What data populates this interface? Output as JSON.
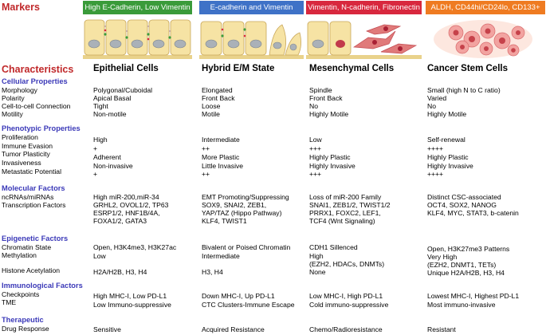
{
  "markers": {
    "title": "Markers",
    "boxes": [
      {
        "label": "High E-Cadherin, Low Vimentin",
        "color": "#3a9b3a"
      },
      {
        "label": "E-cadherin and Vimentin",
        "color": "#3f72c7"
      },
      {
        "label": "Vimentin, N-cadherin, Fibronectin",
        "color": "#d8283e"
      },
      {
        "label": "ALDH, CD44hi/CD24lo, CD133+",
        "color": "#ef7b21"
      }
    ]
  },
  "characteristics": {
    "title": "Characteristics",
    "columns": [
      "Epithelial Cells",
      "Hybrid E/M State",
      "Mesenchymal Cells",
      "Cancer Stem Cells"
    ]
  },
  "sections": [
    {
      "title": "Cellular Properties",
      "rows": [
        {
          "label": "Morphology",
          "values": [
            "Polygonal/Cuboidal",
            "Elongated",
            "Spindle",
            "Small (high N to C ratio)"
          ]
        },
        {
          "label": "Polarity",
          "values": [
            "Apical Basal",
            "Front Back",
            "Front Back",
            "Varied"
          ]
        },
        {
          "label": "Cell-to-cell Connection",
          "values": [
            "Tight",
            "Loose",
            "No",
            "No"
          ]
        },
        {
          "label": "Motility",
          "values": [
            "Non-motile",
            "Motile",
            "Highly Motile",
            "Highly Motile"
          ]
        }
      ]
    },
    {
      "title": "Phenotypic Properties",
      "rows": [
        {
          "label": "Proliferation",
          "values": [
            "High",
            "Intermediate",
            "Low",
            "Self-renewal"
          ]
        },
        {
          "label": "Immune Evasion",
          "values": [
            "+",
            "++",
            "+++",
            "++++"
          ]
        },
        {
          "label": "Tumor Plasticity",
          "values": [
            "Adherent",
            "More Plastic",
            "Highly Plastic",
            "Highly Plastic"
          ]
        },
        {
          "label": "Invasiveness",
          "values": [
            "Non-invasive",
            "Little Invasive",
            "Highly Invasive",
            "Highly Invasive"
          ]
        },
        {
          "label": "Metastatic Potential",
          "values": [
            "+",
            "++",
            "+++",
            "++++"
          ]
        }
      ]
    },
    {
      "title": "Molecular Factors",
      "labels": [
        "ncRNAs/miRNAs",
        "Transcription Factors"
      ],
      "values": [
        [
          "High miR-200,miR-34",
          "GRHL2, OVOL1/2, TP63",
          "ESRP1/2, HNF1B/4A,",
          "FOXA1/2, GATA3"
        ],
        [
          "EMT Promoting/Suppressing",
          "SOX9, SNAI2, ZEB1,",
          "YAP/TAZ (Hippo Pathway)",
          "KLF4, TWIST1"
        ],
        [
          "Loss of miR-200 Family",
          "SNAI1, ZEB1/2, TWIST1/2",
          "PRRX1, FOXC2, LEF1,",
          "TCF4 (Wnt Signaling)"
        ],
        [
          "Distinct CSC-associated",
          "OCT4, SOX2, NANOG",
          "KLF4, MYC, STAT3, b-catenin"
        ]
      ]
    },
    {
      "title": "Epigenetic Factors",
      "labels": [
        "Chromatin State",
        "Methylation",
        "Histone Acetylation"
      ],
      "values": [
        [
          "Open, H3K4me3, H3K27ac",
          "Low",
          "H2A/H2B, H3, H4"
        ],
        [
          "Bivalent or Poised Chromatin",
          "Intermediate",
          "H3, H4"
        ],
        [
          "CDH1 Sillenced",
          "High",
          "(EZH2, HDACs, DNMTs)",
          "None"
        ],
        [
          "Open, H3K27me3 Patterns",
          "Very High",
          "(EZH2, DNMT1, TETs)",
          "Unique H2A/H2B, H3, H4"
        ]
      ]
    },
    {
      "title": "Immunological Factors",
      "rows": [
        {
          "label": "Checkpoints",
          "values": [
            "High MHC-I, Low PD-L1",
            "Down MHC-I, Up PD-L1",
            "Low MHC-I, High PD-L1",
            "Lowest MHC-I, Highest PD-L1"
          ]
        },
        {
          "label": "TME",
          "values": [
            "Low Immuno-suppressive",
            "CTC Clusters-Immune Escape",
            "Cold immuno-suppressive",
            "Most immuno-invasive"
          ]
        }
      ]
    },
    {
      "title": "Therapeutic",
      "rows": [
        {
          "label": "Drug Response",
          "values": [
            "Sensitive",
            "Acquired Resistance",
            "Chemo/Radioresistance",
            "Resistant"
          ]
        }
      ]
    }
  ]
}
